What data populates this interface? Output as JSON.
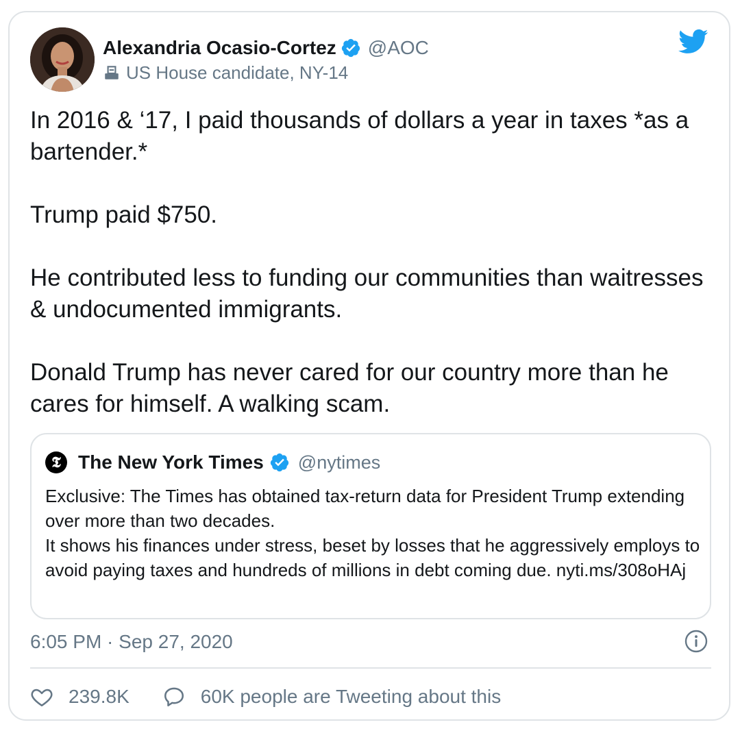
{
  "tweet": {
    "author": {
      "name": "Alexandria Ocasio-Cortez",
      "handle": "@AOC",
      "label": "US House candidate, NY-14",
      "verified": true
    },
    "text": [
      "In 2016 & ‘17, I paid thousands of dollars a year in taxes *as a bartender.*",
      "Trump paid $750.",
      "He contributed less to funding our communities than waitresses & undocumented immigrants.",
      "Donald Trump has never cared for our country more than he cares for himself. A walking scam."
    ],
    "quoted": {
      "name": "The New York Times",
      "handle": "@nytimes",
      "logo_glyph": "𝕿",
      "verified": true,
      "text_line1": "Exclusive: The Times has obtained tax-return data for President Trump extending over more than two decades.",
      "text_line2": "It shows his finances under stress, beset by losses that he aggressively employs to avoid paying taxes and hundreds of millions in debt coming due. nyti.ms/308oHAj"
    },
    "timestamp": "6:05 PM · Sep 27, 2020",
    "likes": "239.8K",
    "conversation": "60K people are Tweeting about this"
  },
  "colors": {
    "twitter_blue": "#1da1f2",
    "text": "#14171a",
    "secondary": "#657786",
    "border": "#dfe3e6"
  },
  "icons": {
    "brand": "twitter-bird-icon",
    "verified": "verified-badge-icon",
    "label": "ballot-box-icon",
    "info": "info-icon",
    "like": "heart-icon",
    "reply": "speech-bubble-icon"
  }
}
